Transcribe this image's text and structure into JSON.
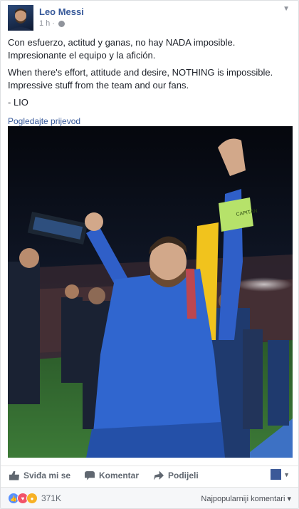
{
  "post": {
    "author": "Leo Messi",
    "time": "1 h",
    "separator": "·",
    "paragraphs": [
      "Con esfuerzo, actitud y ganas, no hay NADA imposible. Impresionante el equipo y la afición.",
      "When there's effort, attitude and desire, NOTHING is impossible. Impressive stuff from the team and our fans.",
      "- LIO"
    ],
    "translate_link": "Pogledajte prijevod",
    "photo_armband_text": "CAPITÁN"
  },
  "actions": {
    "like": "Sviđa mi se",
    "comment": "Komentar",
    "share": "Podijeli"
  },
  "reactions": {
    "count": "371K",
    "types": [
      "like-icon",
      "love-icon",
      "wow-icon"
    ],
    "sort_label": "Najpopularniji komentari",
    "sort_caret": "▾"
  },
  "colors": {
    "link": "#365899",
    "like": "#5890ff",
    "love": "#f25268",
    "wow": "#f7b125",
    "shirt": "#2f5fc8"
  }
}
